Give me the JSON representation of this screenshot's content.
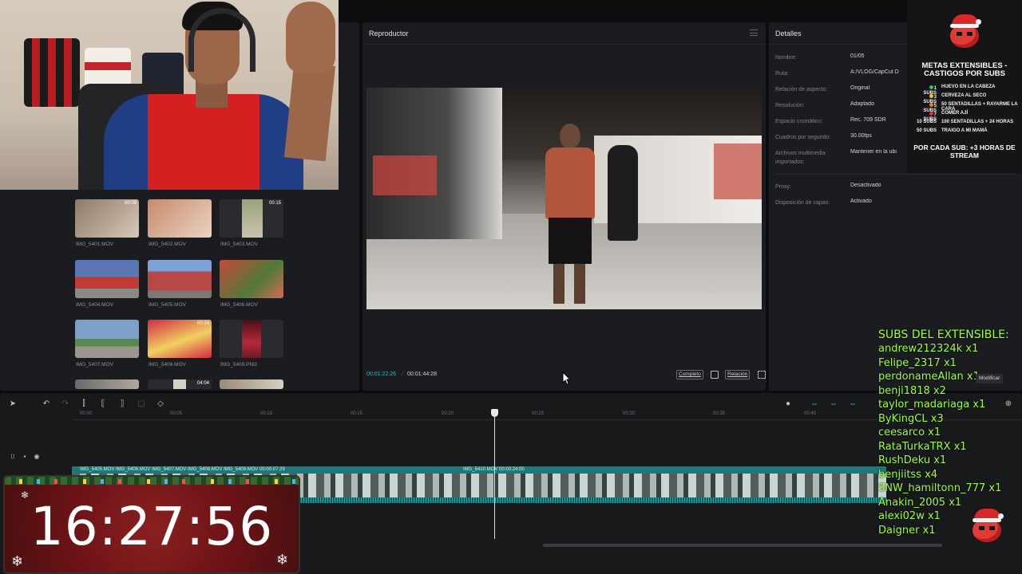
{
  "player": {
    "title": "Reproductor",
    "timecode_current": "00:01:22:26",
    "timecode_total": "00:01:44:28",
    "btn_complete": "Completo",
    "btn_ratio": "Relación"
  },
  "details": {
    "title": "Detalles",
    "rows": [
      {
        "label": "Nombre:",
        "value": "01/05"
      },
      {
        "label": "Ruta:",
        "value": "A:/VLOG/CapCut D"
      },
      {
        "label": "Relación de aspecto:",
        "value": "Original"
      },
      {
        "label": "Resolución:",
        "value": "Adaptado"
      },
      {
        "label": "Espacio cromático:",
        "value": "Rec. 709 SDR"
      },
      {
        "label": "Cuadros por segundo:",
        "value": "30.00fps"
      },
      {
        "label": "Archivos multimedia importados:",
        "value": "Mantener en la ubi"
      },
      {
        "label": "Proxy:",
        "value": "Desactivado"
      },
      {
        "label": "Disposición de capas:",
        "value": "Activado"
      }
    ],
    "modify_button": "Modificar"
  },
  "media": {
    "items": [
      {
        "name": "IMG_5401.MOV",
        "duration": "00:09",
        "color": "#8c7a6a"
      },
      {
        "name": "IMG_5402.MOV",
        "duration": "",
        "color": "#c88a6a"
      },
      {
        "name": "IMG_5403.MOV",
        "duration": "00:15",
        "color": "#9aa47a"
      },
      {
        "name": "IMG_5404.MOV",
        "duration": "",
        "color": "#5a77b4"
      },
      {
        "name": "IMG_5405.MOV",
        "duration": "",
        "color": "#b84848"
      },
      {
        "name": "IMG_5406.MOV",
        "duration": "",
        "color": "#c44a38"
      },
      {
        "name": "IMG_5407.MOV",
        "duration": "",
        "color": "#7ca0c8"
      },
      {
        "name": "IMG_5408.MOV",
        "duration": "00:24",
        "color": "#d22a45"
      },
      {
        "name": "IMG_5409.PNG",
        "duration": "",
        "color": "#7a1a24"
      }
    ],
    "partial_duration": "04:04"
  },
  "timeline": {
    "ticks": [
      "00:00",
      "00:05",
      "00:10",
      "00:15",
      "00:20",
      "00:25",
      "00:30",
      "00:35",
      "00:40"
    ],
    "clip_label_1": "IMG_5405.MOV   IMG_5406.MOV   IMG_5407.MOV   IMG_5408.MOV   IMG_5409.MOV   00:00:07:29",
    "clip_label_2": "IMG_5410.MOV   00:00:24:00"
  },
  "overlay": {
    "metas_title": "METAS EXTENSIBLES - CASTIGOS POR SUBS",
    "metas_items": [
      {
        "subs": "1 SUBS",
        "penalty": "HUEVO EN LA CABEZA",
        "color": "#3fbf4a"
      },
      {
        "subs": "3 SUBS",
        "penalty": "CERVEZA AL SECO",
        "color": "#f0c020"
      },
      {
        "subs": "5 SUBS",
        "penalty": "50 SENTADILLAS + RAYARME LA CARA",
        "color": "#f07a20"
      },
      {
        "subs": "7 SUBS",
        "penalty": "COMER AJÍ",
        "color": "#e03030"
      },
      {
        "subs": "10 SUBS",
        "penalty": "100 SENTADILLAS + 24 HORAS",
        "color": ""
      },
      {
        "subs": "50 SUBS",
        "penalty": "TRAIGO A MI MAMÁ",
        "color": ""
      }
    ],
    "metas_footer": "POR CADA SUB: +3 HORAS DE STREAM",
    "subs_title": "SUBS DEL EXTENSIBLE:",
    "subs": [
      "andrew212324k x1",
      "Felipe_2317 x1",
      "perdonameAllan x1",
      "benji1818 x2",
      "taylor_madariaga x1",
      "ByKingCL x3",
      "ceesarco x1",
      "RataTurkaTRX x1",
      "RushDeku x1",
      "benjiitss x4",
      "SNW_hamiltonn_777 x1",
      "Anakin_2005 x1",
      "alexi02w x1",
      "Daigner x1"
    ],
    "clock": "16:27:56"
  }
}
